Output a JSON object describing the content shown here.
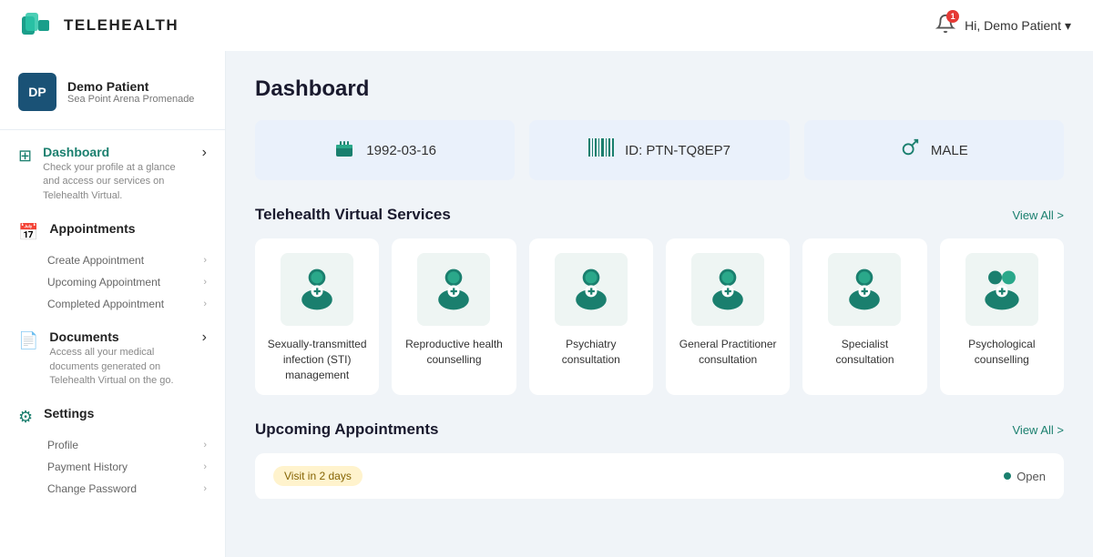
{
  "app": {
    "name": "TELEHEALTH"
  },
  "header": {
    "notification_count": "1",
    "user_greeting": "Hi, Demo Patient",
    "chevron": "▾"
  },
  "sidebar": {
    "user": {
      "initials": "DP",
      "name": "Demo Patient",
      "location": "Sea Point Arena Promenade"
    },
    "nav": [
      {
        "id": "dashboard",
        "label": "Dashboard",
        "desc": "Check your profile at a glance and access our services on Telehealth Virtual.",
        "active": true,
        "sub_items": []
      },
      {
        "id": "appointments",
        "label": "Appointments",
        "desc": "",
        "active": false,
        "sub_items": [
          "Create Appointment",
          "Upcoming Appointment",
          "Completed Appointment"
        ]
      },
      {
        "id": "documents",
        "label": "Documents",
        "desc": "Access all your medical documents generated on Telehealth Virtual on the go.",
        "active": false,
        "sub_items": []
      },
      {
        "id": "settings",
        "label": "Settings",
        "desc": "",
        "active": false,
        "sub_items": [
          "Profile",
          "Payment History",
          "Change Password"
        ]
      }
    ]
  },
  "main": {
    "page_title": "Dashboard",
    "info_cards": [
      {
        "icon": "🎂",
        "value": "1992-03-16"
      },
      {
        "icon": "|||",
        "value": "ID: PTN-TQ8EP7"
      },
      {
        "icon": "♂",
        "value": "MALE"
      }
    ],
    "services_section": {
      "title": "Telehealth Virtual Services",
      "view_all": "View All >",
      "services": [
        {
          "label": "Sexually-transmitted infection (STI) management"
        },
        {
          "label": "Reproductive health counselling"
        },
        {
          "label": "Psychiatry consultation"
        },
        {
          "label": "General Practitioner consultation"
        },
        {
          "label": "Specialist consultation"
        },
        {
          "label": "Psychological counselling"
        }
      ]
    },
    "appointments_section": {
      "title": "Upcoming Appointments",
      "view_all": "View All >",
      "items": [
        {
          "badge": "Visit in 2 days",
          "status": "Open"
        }
      ]
    }
  }
}
